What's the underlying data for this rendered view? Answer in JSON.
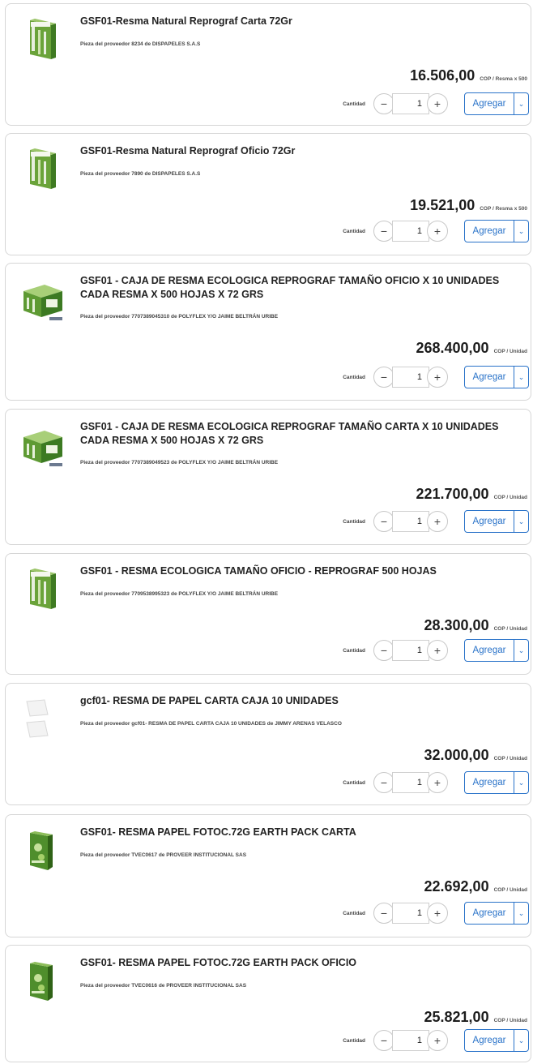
{
  "labels": {
    "quantity": "Cantidad",
    "add": "Agregar",
    "minus": "−",
    "plus": "+"
  },
  "products": [
    {
      "title": "GSF01-Resma Natural Reprograf Carta 72Gr",
      "supplier": "Pieza del proveedor 8234 de DISPAPELES S.A.S",
      "price": "16.506,00",
      "unit": "COP / Resma x 500",
      "quantity": "1",
      "icon": "ream-green-icon"
    },
    {
      "title": "GSF01-Resma Natural Reprograf Oficio 72Gr",
      "supplier": "Pieza del proveedor 7890 de DISPAPELES S.A.S",
      "price": "19.521,00",
      "unit": "COP / Resma x 500",
      "quantity": "1",
      "icon": "ream-green-icon"
    },
    {
      "title": "GSF01 - CAJA DE RESMA ECOLOGICA REPROGRAF TAMAÑO OFICIO X 10 UNIDADES CADA RESMA X 500 HOJAS X 72 GRS",
      "supplier": "Pieza del proveedor 7707389045310 de POLYFLEX Y/O JAIME BELTRÁN URIBE",
      "price": "268.400,00",
      "unit": "COP / Unidad",
      "quantity": "1",
      "icon": "paper-box-icon"
    },
    {
      "title": "GSF01 - CAJA DE RESMA ECOLOGICA REPROGRAF TAMAÑO CARTA X 10 UNIDADES CADA RESMA X 500 HOJAS X 72 GRS",
      "supplier": "Pieza del proveedor 7707389049523 de POLYFLEX Y/O JAIME BELTRÁN URIBE",
      "price": "221.700,00",
      "unit": "COP / Unidad",
      "quantity": "1",
      "icon": "paper-box-icon"
    },
    {
      "title": "GSF01 - RESMA ECOLOGICA TAMAÑO OFICIO - REPROGRAF 500 HOJAS",
      "supplier": "Pieza del proveedor 7709538995323 de POLYFLEX Y/O JAIME BELTRÁN URIBE",
      "price": "28.300,00",
      "unit": "COP / Unidad",
      "quantity": "1",
      "icon": "ream-green-icon"
    },
    {
      "title": "gcf01- RESMA DE PAPEL CARTA CAJA 10 UNIDADES",
      "supplier": "Pieza del proveedor gcf01- RESMA DE PAPEL CARTA CAJA 10 UNIDADES de JIMMY ARENAS VELASCO",
      "price": "32.000,00",
      "unit": "COP / Unidad",
      "quantity": "1",
      "icon": "white-paper-icon"
    },
    {
      "title": "GSF01- RESMA PAPEL FOTOC.72G EARTH PACK CARTA",
      "supplier": "Pieza del proveedor TVEC0617 de PROVEER INSTITUCIONAL SAS",
      "price": "22.692,00",
      "unit": "COP / Unidad",
      "quantity": "1",
      "icon": "earth-pack-icon"
    },
    {
      "title": "GSF01- RESMA PAPEL FOTOC.72G EARTH PACK OFICIO",
      "supplier": "Pieza del proveedor TVEC0616 de PROVEER INSTITUCIONAL SAS",
      "price": "25.821,00",
      "unit": "COP / Unidad",
      "quantity": "1",
      "icon": "earth-pack-icon"
    }
  ]
}
